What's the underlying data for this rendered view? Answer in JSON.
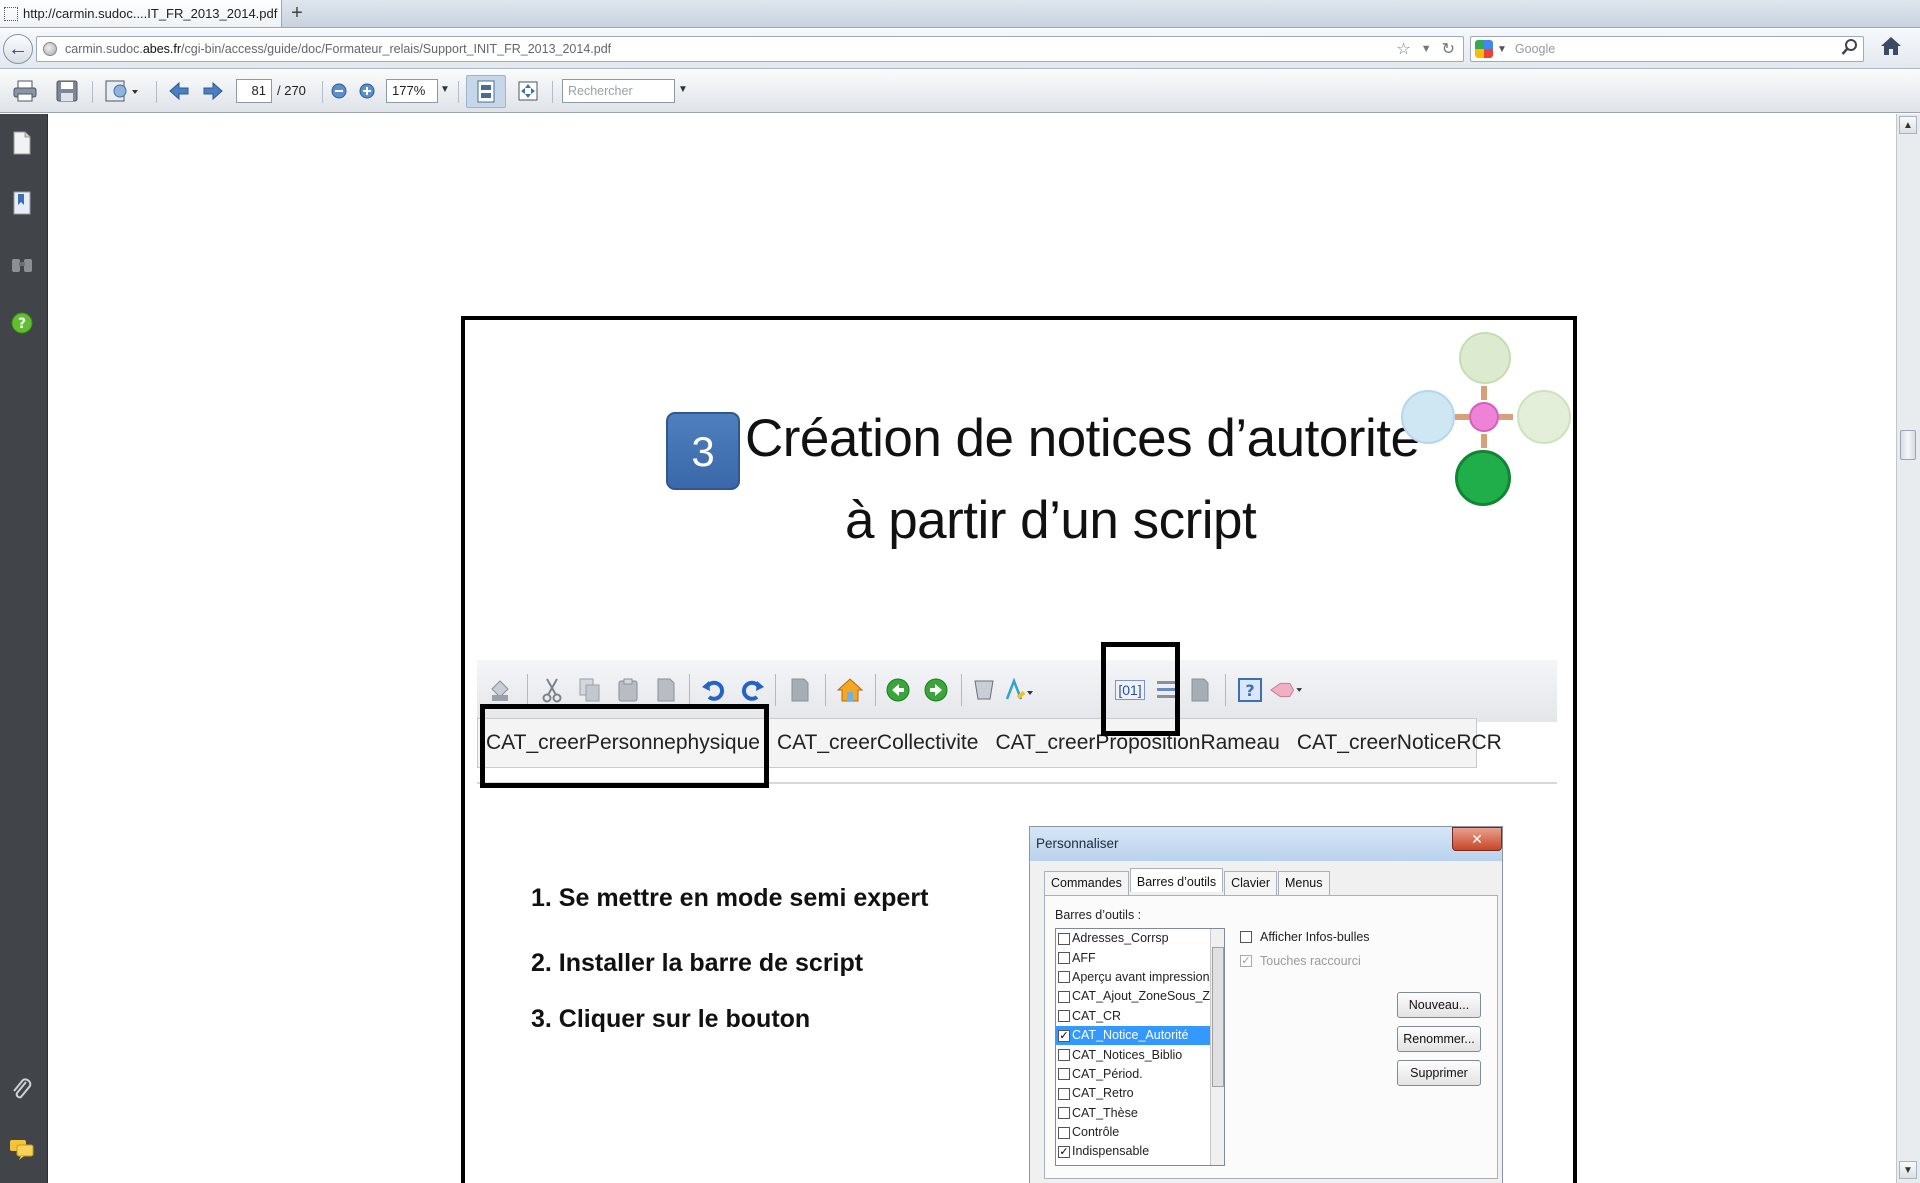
{
  "browser": {
    "tab_title": "http://carmin.sudoc....IT_FR_2013_2014.pdf",
    "new_tab_label": "+",
    "url_prefix": "carmin.sudoc.",
    "url_host": "abes.fr",
    "url_path": "/cgi-bin/access/guide/doc/Formateur_relais/Support_INIT_FR_2013_2014.pdf",
    "search_placeholder": "Google"
  },
  "pdf_toolbar": {
    "current_page": "81",
    "total_pages": "/ 270",
    "zoom": "177%",
    "find_placeholder": "Rechercher"
  },
  "slide": {
    "step_number": "3",
    "title_line1": "Création de notices d’autorité",
    "title_line2": "à partir d’un script",
    "scripts": [
      "CAT_creerPersonnephysique",
      "CAT_creerCollectivite",
      "CAT_creerPropositionRameau",
      "CAT_creerNoticeRCR"
    ],
    "script_button_label": "[01]",
    "steps": [
      "1. Se mettre en mode semi expert",
      "2. Installer la barre de script",
      "3. Cliquer sur le bouton"
    ]
  },
  "dialog": {
    "title": "Personnaliser",
    "close_label": "✕",
    "tabs": [
      "Commandes",
      "Barres d’outils",
      "Clavier",
      "Menus"
    ],
    "active_tab": 1,
    "toolbars_label": "Barres d’outils :",
    "toolbars": [
      {
        "label": "Adresses_Corrsp",
        "checked": false,
        "selected": false
      },
      {
        "label": "AFF",
        "checked": false,
        "selected": false
      },
      {
        "label": "Aperçu avant impression",
        "checked": false,
        "selected": false
      },
      {
        "label": "CAT_Ajout_ZoneSous_Z",
        "checked": false,
        "selected": false
      },
      {
        "label": "CAT_CR",
        "checked": false,
        "selected": false
      },
      {
        "label": "CAT_Notice_Autorité",
        "checked": true,
        "selected": true
      },
      {
        "label": "CAT_Notices_Biblio",
        "checked": false,
        "selected": false
      },
      {
        "label": "CAT_Périod.",
        "checked": false,
        "selected": false
      },
      {
        "label": "CAT_Retro",
        "checked": false,
        "selected": false
      },
      {
        "label": "CAT_Thèse",
        "checked": false,
        "selected": false
      },
      {
        "label": "Contrôle",
        "checked": false,
        "selected": false
      },
      {
        "label": "Indispensable",
        "checked": true,
        "selected": false
      }
    ],
    "option_tooltips": "Afficher Infos-bulles",
    "option_shortcuts": "Touches raccourci",
    "btn_new": "Nouveau...",
    "btn_rename": "Renommer...",
    "btn_delete": "Supprimer"
  }
}
